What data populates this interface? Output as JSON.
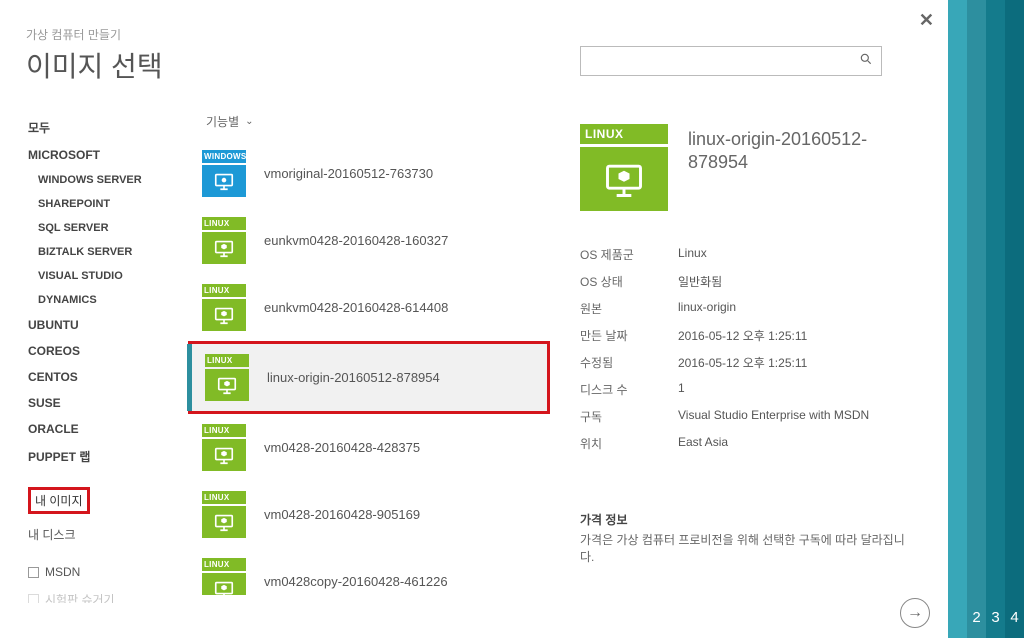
{
  "breadcrumb": "가상 컴퓨터 만들기",
  "page_title": "이미지 선택",
  "search": {
    "placeholder": ""
  },
  "sort_label": "기능별",
  "sidebar": {
    "items": [
      {
        "label": "모두",
        "type": "bold"
      },
      {
        "label": "MICROSOFT",
        "type": "bold"
      },
      {
        "label": "WINDOWS SERVER",
        "type": "sub"
      },
      {
        "label": "SHAREPOINT",
        "type": "sub"
      },
      {
        "label": "SQL SERVER",
        "type": "sub"
      },
      {
        "label": "BIZTALK SERVER",
        "type": "sub"
      },
      {
        "label": "VISUAL STUDIO",
        "type": "sub"
      },
      {
        "label": "DYNAMICS",
        "type": "sub"
      },
      {
        "label": "UBUNTU",
        "type": "bold"
      },
      {
        "label": "COREOS",
        "type": "bold"
      },
      {
        "label": "CENTOS",
        "type": "bold"
      },
      {
        "label": "SUSE",
        "type": "bold"
      },
      {
        "label": "ORACLE",
        "type": "bold"
      },
      {
        "label": "PUPPET 랩",
        "type": "bold"
      }
    ],
    "group2": [
      {
        "label": "내 이미지",
        "selected": true,
        "boxed": true
      },
      {
        "label": "내 디스크"
      }
    ],
    "group3": [
      {
        "label": "MSDN"
      },
      {
        "label": "시험판 슈거기"
      }
    ]
  },
  "images": [
    {
      "os": "windows",
      "os_tag": "WINDOWS",
      "label": "vmoriginal-20160512-763730"
    },
    {
      "os": "linux",
      "os_tag": "LINUX",
      "label": "eunkvm0428-20160428-160327"
    },
    {
      "os": "linux",
      "os_tag": "LINUX",
      "label": "eunkvm0428-20160428-614408"
    },
    {
      "os": "linux",
      "os_tag": "LINUX",
      "label": "linux-origin-20160512-878954",
      "selected": true,
      "boxed": true
    },
    {
      "os": "linux",
      "os_tag": "LINUX",
      "label": "vm0428-20160428-428375"
    },
    {
      "os": "linux",
      "os_tag": "LINUX",
      "label": "vm0428-20160428-905169"
    },
    {
      "os": "linux",
      "os_tag": "LINUX",
      "label": "vm0428copy-20160428-461226"
    }
  ],
  "detail": {
    "os_tag": "LINUX",
    "title": "linux-origin-20160512-878954",
    "fields": [
      {
        "k": "OS 제품군",
        "v": "Linux"
      },
      {
        "k": "OS 상태",
        "v": "일반화됨"
      },
      {
        "k": "원본",
        "v": "linux-origin"
      },
      {
        "k": "만든 날짜",
        "v": "2016-05-12 오후 1:25:11"
      },
      {
        "k": "수정됨",
        "v": "2016-05-12 오후 1:25:11"
      },
      {
        "k": "디스크 수",
        "v": "1"
      },
      {
        "k": "구독",
        "v": "Visual Studio Enterprise with MSDN"
      },
      {
        "k": "위치",
        "v": "East Asia"
      }
    ],
    "price_heading": "가격 정보",
    "price_text": "가격은 가상 컴퓨터 프로비전을 위해 선택한 구독에 따라 달라집니다."
  },
  "steps": [
    "",
    "2",
    "3",
    "4"
  ]
}
